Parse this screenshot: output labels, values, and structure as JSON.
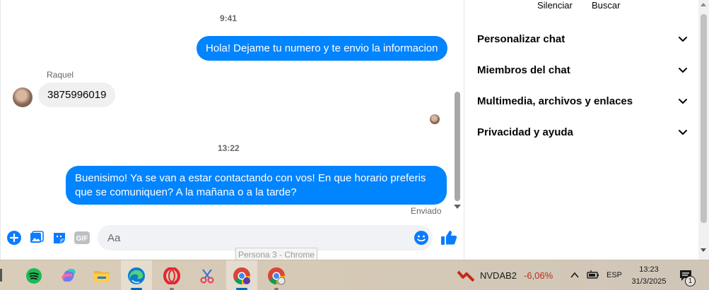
{
  "chat": {
    "time1": "9:41",
    "msg1": "Hola! Dejame tu numero y te envio la informacion",
    "sender": "Raquel",
    "msg2": "3875996019",
    "time2": "13:22",
    "msg3_line1": "Buenisimo! Ya se van a estar contactando con vos! En que horario preferis",
    "msg3_line2": "que se comuniquen? A la mañana o a la tarde?",
    "status": "Enviado"
  },
  "composer": {
    "placeholder": "Aa",
    "gif_label": "GIF"
  },
  "tooltip": "Persona 3 - Chrome",
  "panel": {
    "silence": "Silenciar",
    "search": "Buscar",
    "sections": [
      "Personalizar chat",
      "Miembros del chat",
      "Multimedia, archivos y enlaces",
      "Privacidad y ayuda"
    ]
  },
  "taskbar": {
    "stock_symbol": "NVDAB2",
    "stock_change": "-6,06%",
    "lang": "ESP",
    "time": "13:23",
    "date": "31/3/2025",
    "notif_count": "1",
    "apps": [
      "spotify-icon",
      "copilot-icon",
      "file-explorer-icon",
      "edge-icon",
      "opera-icon",
      "snipping-icon",
      "chrome-persona-icon",
      "chrome-icon"
    ]
  },
  "colors": {
    "outgoing_bubble": "#0084ff",
    "incoming_bubble": "#f0f0f0",
    "messenger_blue": "#0a7cff",
    "stock_red": "#c42b1c"
  }
}
